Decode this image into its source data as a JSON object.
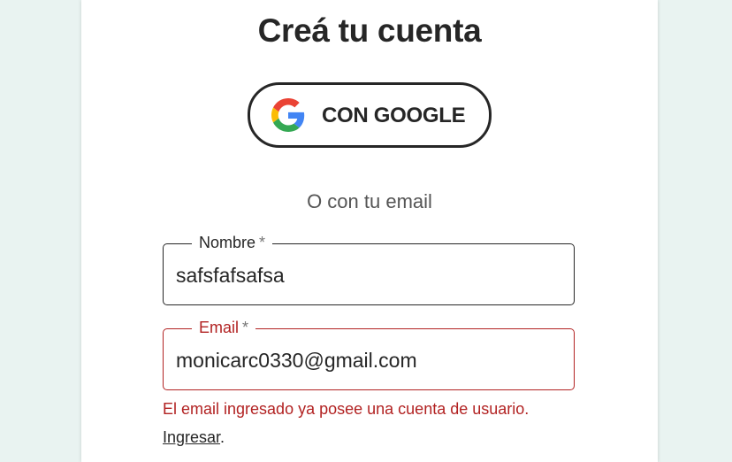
{
  "page": {
    "title": "Creá tu cuenta",
    "google_button_label": "CON GOOGLE",
    "divider_text": "O con tu email"
  },
  "form": {
    "name": {
      "label": "Nombre",
      "required_mark": "*",
      "value": "safsfafsafsa"
    },
    "email": {
      "label": "Email",
      "required_mark": "*",
      "value": "monicarc0330@gmail.com",
      "error": "El email ingresado ya posee una cuenta de usuario."
    },
    "login_link": "Ingresar",
    "login_suffix": "."
  },
  "icons": {
    "google": "google-g-icon"
  },
  "colors": {
    "background": "#e9f3f1",
    "text": "#262626",
    "error": "#b22222",
    "google_blue": "#4285F4",
    "google_red": "#EA4335",
    "google_yellow": "#FBBC05",
    "google_green": "#34A853"
  }
}
